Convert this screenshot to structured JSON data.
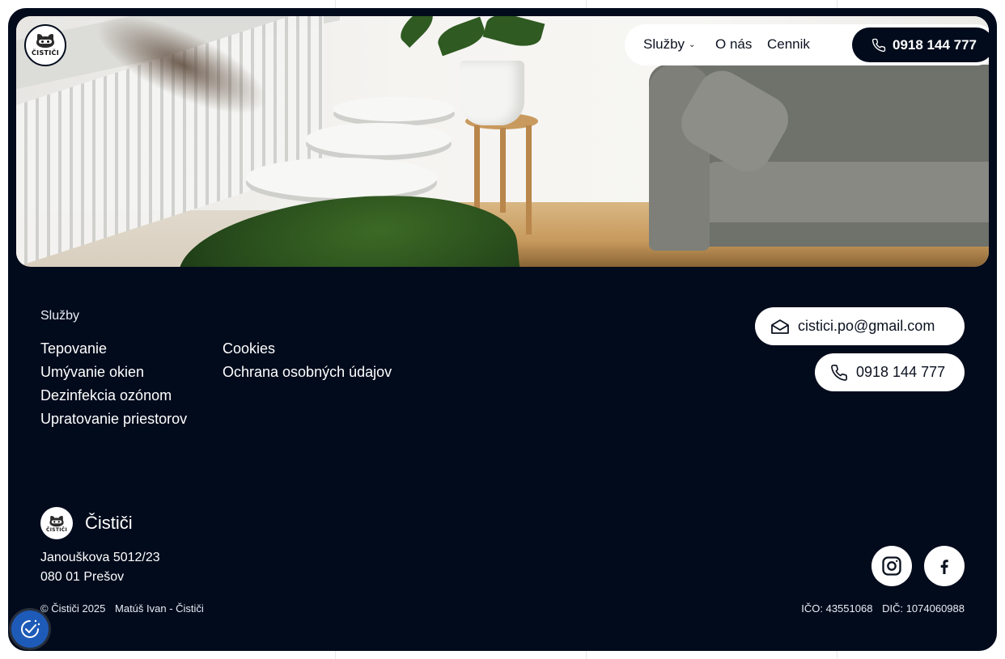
{
  "brand": {
    "logo_text": "ČISTIČI",
    "name": "Čističi"
  },
  "nav": {
    "services_label": "Služby",
    "about_label": "O nás",
    "pricing_label": "Cennik",
    "phone_label": "0918 144 777"
  },
  "footer": {
    "heading": "Služby",
    "services": [
      "Tepovanie",
      "Umývanie okien",
      "Dezinfekcia ozónom",
      "Upratovanie priestorov"
    ],
    "legal": [
      "Cookies",
      "Ochrana osobných údajov"
    ],
    "email": "cistici.po@gmail.com",
    "phone": "0918 144 777",
    "address_line1": "Janouškova 5012/23",
    "address_line2": "080 01 Prešov",
    "copyright": "© Čističi 2025",
    "owner": "Matúš Ivan - Čističi",
    "ico": "IČO: 43551068",
    "dic": "DIČ: 1074060988"
  },
  "icons": {
    "phone": "phone-icon",
    "email": "envelope-icon",
    "instagram": "instagram-icon",
    "facebook": "facebook-icon",
    "consent": "cookie-consent-icon",
    "chevron": "chevron-down-icon"
  },
  "colors": {
    "background": "#020b1c",
    "surface": "#ffffff",
    "text_light": "#ffffff",
    "consent_button": "#1e5bb8"
  }
}
